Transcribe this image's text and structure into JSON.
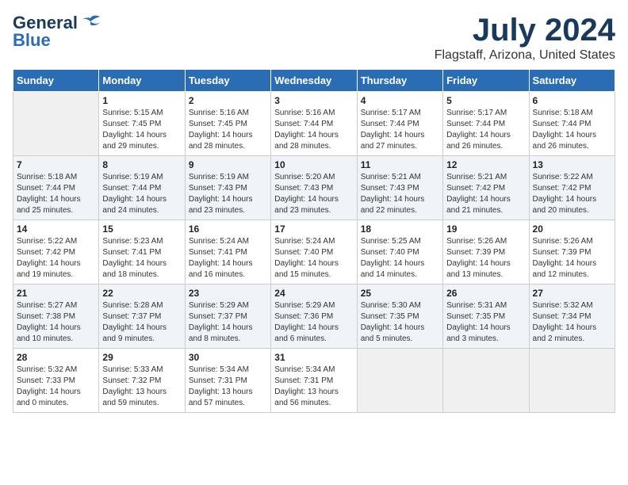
{
  "header": {
    "logo_general": "General",
    "logo_blue": "Blue",
    "title": "July 2024",
    "subtitle": "Flagstaff, Arizona, United States"
  },
  "days_of_week": [
    "Sunday",
    "Monday",
    "Tuesday",
    "Wednesday",
    "Thursday",
    "Friday",
    "Saturday"
  ],
  "weeks": [
    [
      {
        "num": "",
        "info": "",
        "empty": true
      },
      {
        "num": "1",
        "info": "Sunrise: 5:15 AM\nSunset: 7:45 PM\nDaylight: 14 hours\nand 29 minutes."
      },
      {
        "num": "2",
        "info": "Sunrise: 5:16 AM\nSunset: 7:45 PM\nDaylight: 14 hours\nand 28 minutes."
      },
      {
        "num": "3",
        "info": "Sunrise: 5:16 AM\nSunset: 7:44 PM\nDaylight: 14 hours\nand 28 minutes."
      },
      {
        "num": "4",
        "info": "Sunrise: 5:17 AM\nSunset: 7:44 PM\nDaylight: 14 hours\nand 27 minutes."
      },
      {
        "num": "5",
        "info": "Sunrise: 5:17 AM\nSunset: 7:44 PM\nDaylight: 14 hours\nand 26 minutes."
      },
      {
        "num": "6",
        "info": "Sunrise: 5:18 AM\nSunset: 7:44 PM\nDaylight: 14 hours\nand 26 minutes."
      }
    ],
    [
      {
        "num": "7",
        "info": "Sunrise: 5:18 AM\nSunset: 7:44 PM\nDaylight: 14 hours\nand 25 minutes."
      },
      {
        "num": "8",
        "info": "Sunrise: 5:19 AM\nSunset: 7:44 PM\nDaylight: 14 hours\nand 24 minutes."
      },
      {
        "num": "9",
        "info": "Sunrise: 5:19 AM\nSunset: 7:43 PM\nDaylight: 14 hours\nand 23 minutes."
      },
      {
        "num": "10",
        "info": "Sunrise: 5:20 AM\nSunset: 7:43 PM\nDaylight: 14 hours\nand 23 minutes."
      },
      {
        "num": "11",
        "info": "Sunrise: 5:21 AM\nSunset: 7:43 PM\nDaylight: 14 hours\nand 22 minutes."
      },
      {
        "num": "12",
        "info": "Sunrise: 5:21 AM\nSunset: 7:42 PM\nDaylight: 14 hours\nand 21 minutes."
      },
      {
        "num": "13",
        "info": "Sunrise: 5:22 AM\nSunset: 7:42 PM\nDaylight: 14 hours\nand 20 minutes."
      }
    ],
    [
      {
        "num": "14",
        "info": "Sunrise: 5:22 AM\nSunset: 7:42 PM\nDaylight: 14 hours\nand 19 minutes."
      },
      {
        "num": "15",
        "info": "Sunrise: 5:23 AM\nSunset: 7:41 PM\nDaylight: 14 hours\nand 18 minutes."
      },
      {
        "num": "16",
        "info": "Sunrise: 5:24 AM\nSunset: 7:41 PM\nDaylight: 14 hours\nand 16 minutes."
      },
      {
        "num": "17",
        "info": "Sunrise: 5:24 AM\nSunset: 7:40 PM\nDaylight: 14 hours\nand 15 minutes."
      },
      {
        "num": "18",
        "info": "Sunrise: 5:25 AM\nSunset: 7:40 PM\nDaylight: 14 hours\nand 14 minutes."
      },
      {
        "num": "19",
        "info": "Sunrise: 5:26 AM\nSunset: 7:39 PM\nDaylight: 14 hours\nand 13 minutes."
      },
      {
        "num": "20",
        "info": "Sunrise: 5:26 AM\nSunset: 7:39 PM\nDaylight: 14 hours\nand 12 minutes."
      }
    ],
    [
      {
        "num": "21",
        "info": "Sunrise: 5:27 AM\nSunset: 7:38 PM\nDaylight: 14 hours\nand 10 minutes."
      },
      {
        "num": "22",
        "info": "Sunrise: 5:28 AM\nSunset: 7:37 PM\nDaylight: 14 hours\nand 9 minutes."
      },
      {
        "num": "23",
        "info": "Sunrise: 5:29 AM\nSunset: 7:37 PM\nDaylight: 14 hours\nand 8 minutes."
      },
      {
        "num": "24",
        "info": "Sunrise: 5:29 AM\nSunset: 7:36 PM\nDaylight: 14 hours\nand 6 minutes."
      },
      {
        "num": "25",
        "info": "Sunrise: 5:30 AM\nSunset: 7:35 PM\nDaylight: 14 hours\nand 5 minutes."
      },
      {
        "num": "26",
        "info": "Sunrise: 5:31 AM\nSunset: 7:35 PM\nDaylight: 14 hours\nand 3 minutes."
      },
      {
        "num": "27",
        "info": "Sunrise: 5:32 AM\nSunset: 7:34 PM\nDaylight: 14 hours\nand 2 minutes."
      }
    ],
    [
      {
        "num": "28",
        "info": "Sunrise: 5:32 AM\nSunset: 7:33 PM\nDaylight: 14 hours\nand 0 minutes."
      },
      {
        "num": "29",
        "info": "Sunrise: 5:33 AM\nSunset: 7:32 PM\nDaylight: 13 hours\nand 59 minutes."
      },
      {
        "num": "30",
        "info": "Sunrise: 5:34 AM\nSunset: 7:31 PM\nDaylight: 13 hours\nand 57 minutes."
      },
      {
        "num": "31",
        "info": "Sunrise: 5:34 AM\nSunset: 7:31 PM\nDaylight: 13 hours\nand 56 minutes."
      },
      {
        "num": "",
        "info": "",
        "empty": true
      },
      {
        "num": "",
        "info": "",
        "empty": true
      },
      {
        "num": "",
        "info": "",
        "empty": true
      }
    ]
  ]
}
